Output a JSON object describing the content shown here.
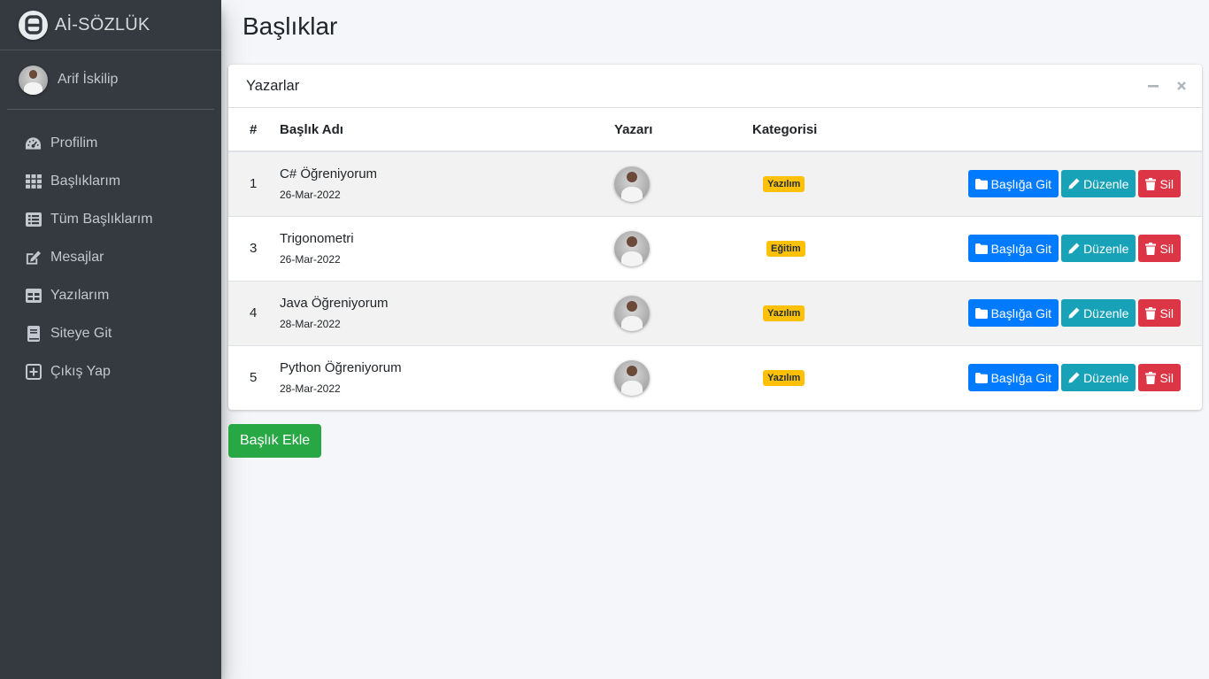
{
  "brand": {
    "name": "Aİ-SÖZLÜK",
    "logo_letter": "A"
  },
  "user": {
    "name": "Arif İskilip"
  },
  "sidebar": {
    "items": [
      {
        "label": "Profilim",
        "icon": "tachometer-icon"
      },
      {
        "label": "Başlıklarım",
        "icon": "grid-icon"
      },
      {
        "label": "Tüm Başlıklarım",
        "icon": "list-icon"
      },
      {
        "label": "Mesajlar",
        "icon": "edit-icon"
      },
      {
        "label": "Yazılarım",
        "icon": "table-icon"
      },
      {
        "label": "Siteye Git",
        "icon": "book-icon"
      },
      {
        "label": "Çıkış Yap",
        "icon": "plus-square-icon"
      }
    ]
  },
  "page": {
    "title": "Başlıklar"
  },
  "card": {
    "title": "Yazarlar",
    "columns": [
      "#",
      "Başlık Adı",
      "Yazarı",
      "Kategorisi",
      ""
    ],
    "rows": [
      {
        "id": "1",
        "title": "C# Öğreniyorum",
        "date": "26-Mar-2022",
        "category": "Yazılım"
      },
      {
        "id": "3",
        "title": "Trigonometri",
        "date": "26-Mar-2022",
        "category": "Eğitim"
      },
      {
        "id": "4",
        "title": "Java Öğreniyorum",
        "date": "28-Mar-2022",
        "category": "Yazılım"
      },
      {
        "id": "5",
        "title": "Python Öğreniyorum",
        "date": "28-Mar-2022",
        "category": "Yazılım"
      }
    ],
    "actions": {
      "go": "Başlığa Git",
      "edit": "Düzenle",
      "delete": "Sil"
    }
  },
  "add_button": {
    "label": "Başlık Ekle"
  },
  "colors": {
    "sidebar_bg": "#343a40",
    "primary": "#007bff",
    "info": "#17a2b8",
    "danger": "#dc3545",
    "success": "#28a745",
    "warning": "#ffc107"
  }
}
